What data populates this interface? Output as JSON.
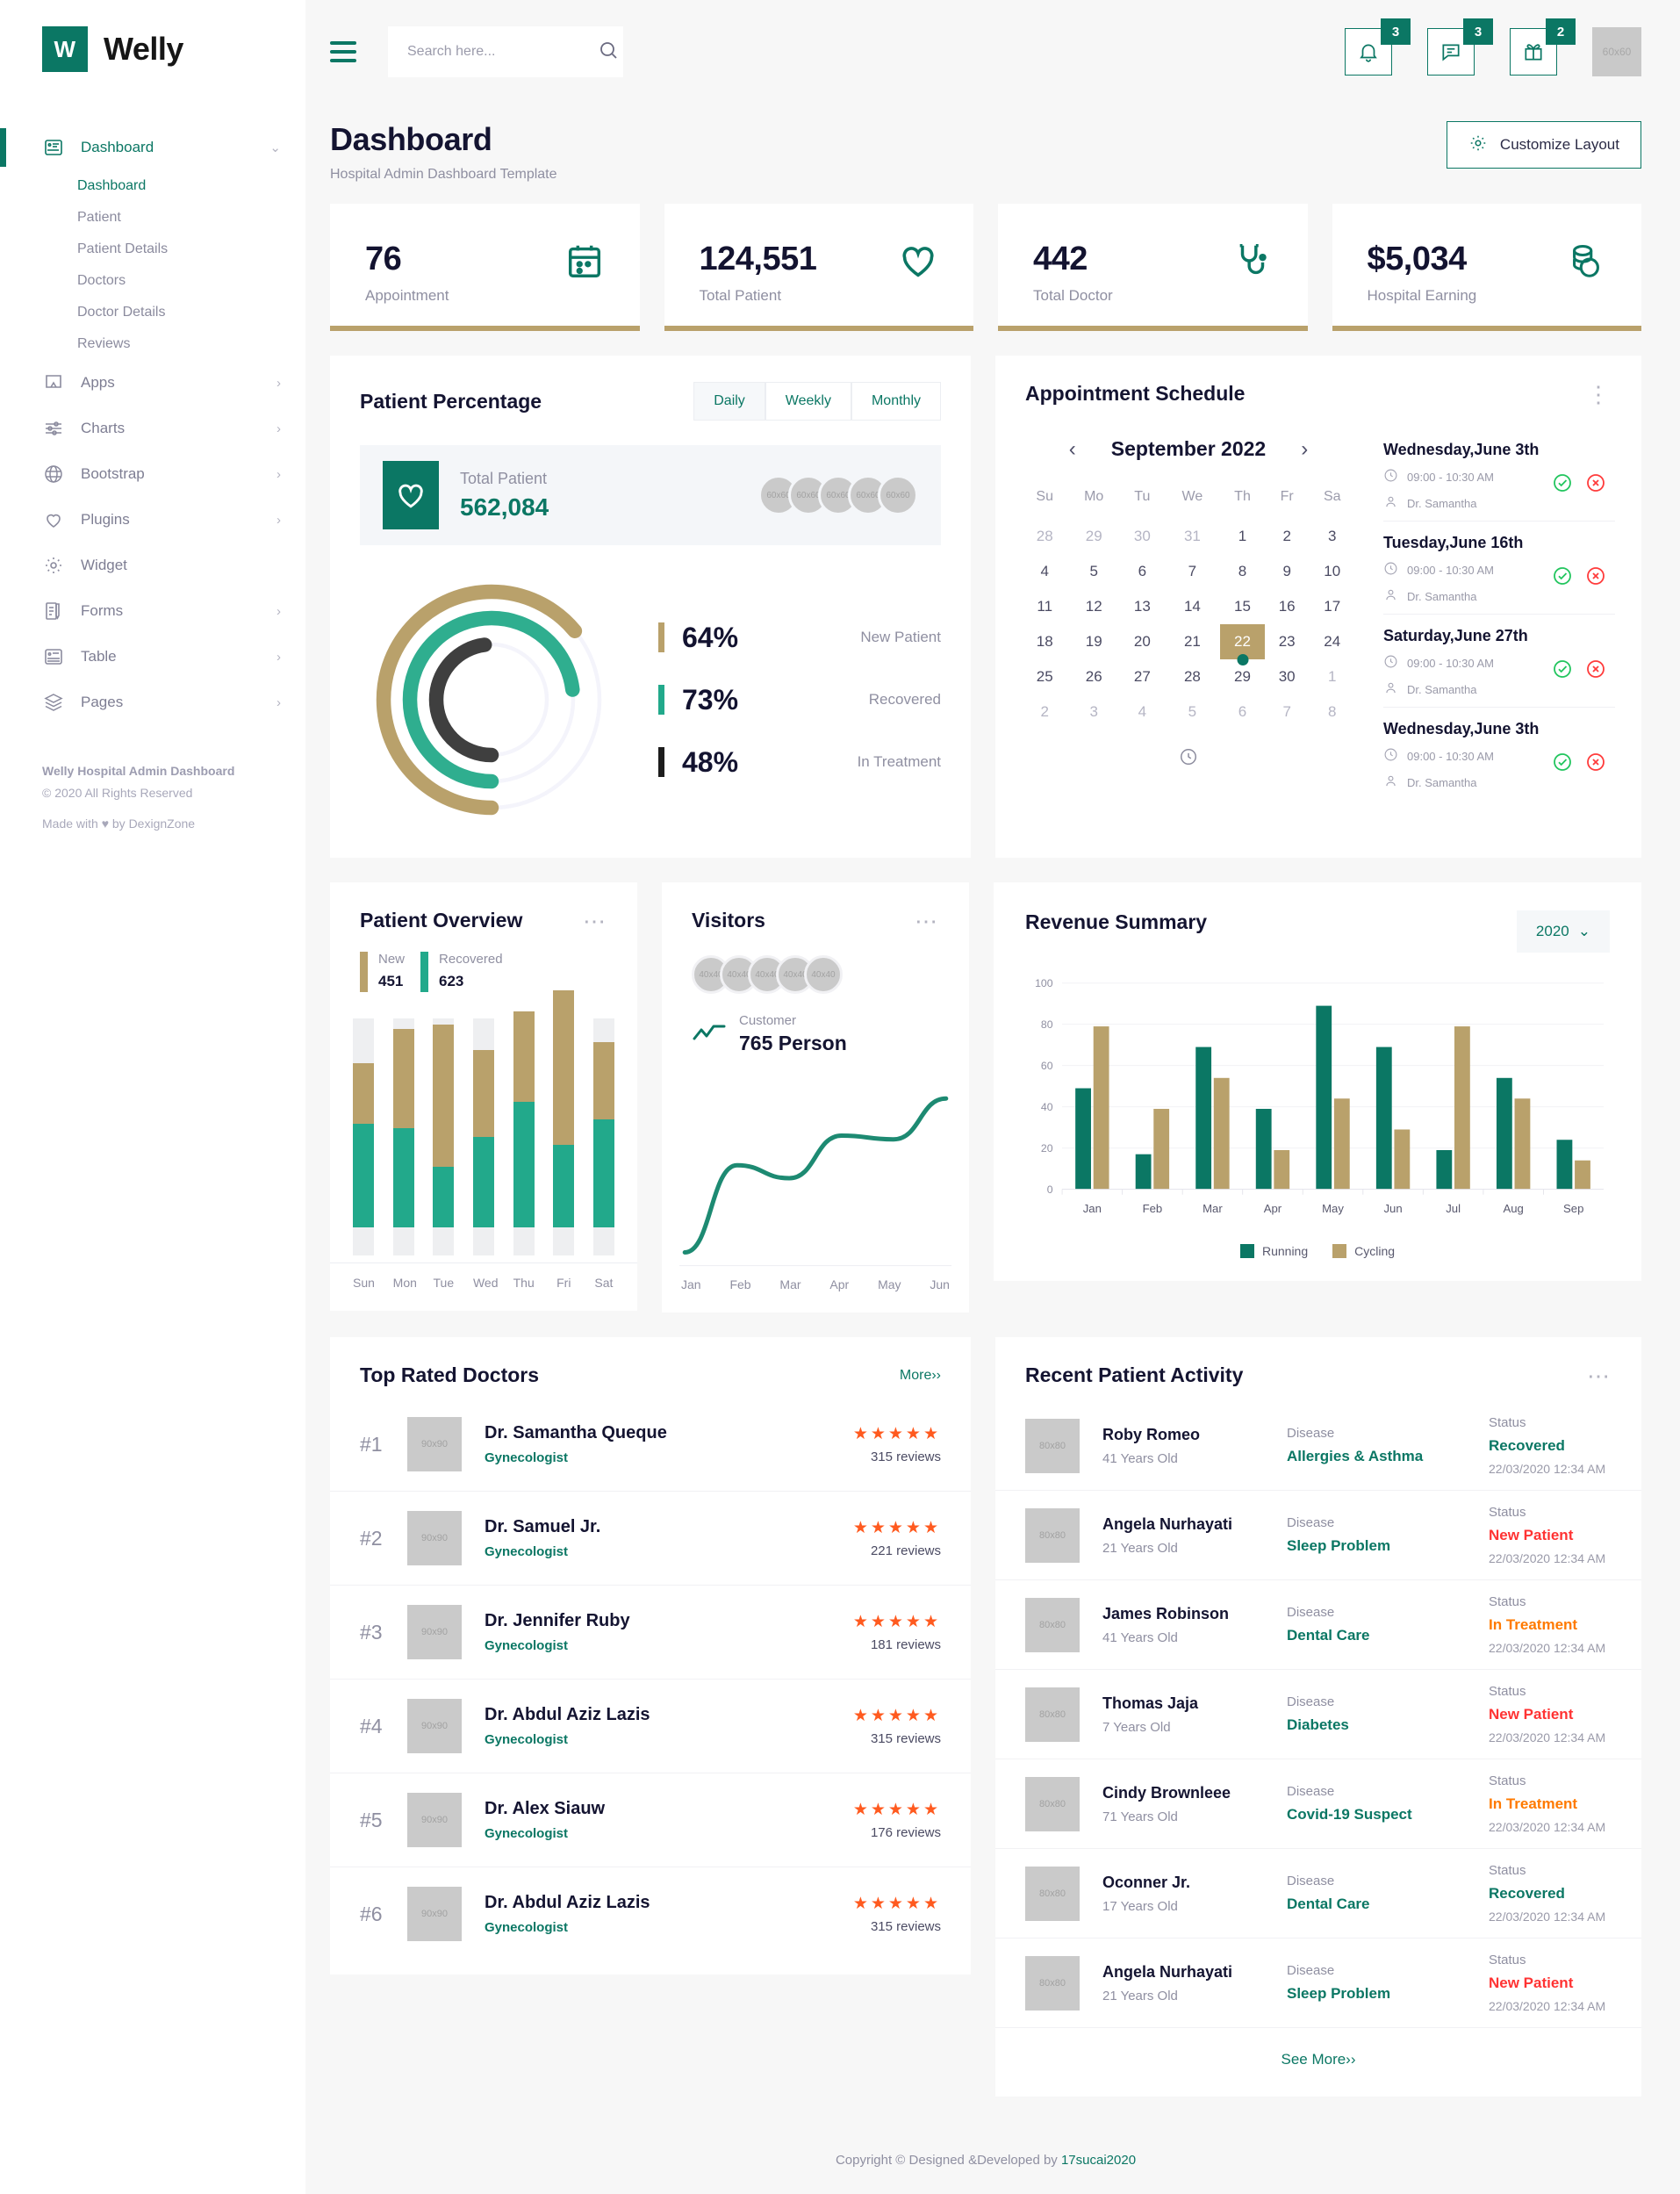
{
  "brand": {
    "mark": "W",
    "name": "Welly"
  },
  "sidebar": {
    "items": [
      {
        "label": "Dashboard",
        "icon": "dashboard-icon",
        "caret": "⌄",
        "active": true
      },
      {
        "label": "Apps",
        "icon": "apps-icon",
        "caret": "›"
      },
      {
        "label": "Charts",
        "icon": "charts-icon",
        "caret": "›"
      },
      {
        "label": "Bootstrap",
        "icon": "globe-icon",
        "caret": "›"
      },
      {
        "label": "Plugins",
        "icon": "heart-icon",
        "caret": "›"
      },
      {
        "label": "Widget",
        "icon": "gear-icon",
        "caret": ""
      },
      {
        "label": "Forms",
        "icon": "forms-icon",
        "caret": "›"
      },
      {
        "label": "Table",
        "icon": "table-icon",
        "caret": "›"
      },
      {
        "label": "Pages",
        "icon": "pages-icon",
        "caret": "›"
      }
    ],
    "sub_items": [
      {
        "label": "Dashboard",
        "active": true
      },
      {
        "label": "Patient"
      },
      {
        "label": "Patient Details"
      },
      {
        "label": "Doctors"
      },
      {
        "label": "Doctor Details"
      },
      {
        "label": "Reviews"
      }
    ],
    "footer": {
      "title": "Welly Hospital Admin Dashboard",
      "copyright": "© 2020 All Rights Reserved",
      "made": "Made with ♥ by DexignZone"
    }
  },
  "header": {
    "search_placeholder": "Search here...",
    "notifications_badge": "3",
    "messages_badge": "3",
    "gifts_badge": "2",
    "avatar_label": "60x60"
  },
  "page": {
    "title": "Dashboard",
    "subtitle": "Hospital Admin Dashboard Template",
    "customize_label": "Customize Layout"
  },
  "stats": [
    {
      "value": "76",
      "label": "Appointment",
      "icon": "calendar-icon"
    },
    {
      "value": "124,551",
      "label": "Total Patient",
      "icon": "heart-icon"
    },
    {
      "value": "442",
      "label": "Total Doctor",
      "icon": "stethoscope-icon"
    },
    {
      "value": "$5,034",
      "label": "Hospital Earning",
      "icon": "coins-icon"
    }
  ],
  "patient_percentage": {
    "title": "Patient Percentage",
    "tabs": [
      {
        "label": "Daily",
        "active": true
      },
      {
        "label": "Weekly",
        "active": false
      },
      {
        "label": "Monthly",
        "active": false
      }
    ],
    "total_label": "Total Patient",
    "total_value": "562,084",
    "avatars": [
      "60x60",
      "60x60",
      "60x60",
      "60x60",
      "60x60"
    ],
    "chart_data": {
      "type": "pie",
      "title": "Patient Percentage",
      "legend_position": "right",
      "categories": [
        "New Patient",
        "Recovered",
        "In Treatment"
      ],
      "values": [
        64,
        73,
        48
      ],
      "labels": [
        "64%",
        "73%",
        "48%"
      ],
      "colors": [
        "#b9a16b",
        "#2fae8f",
        "#3f3f3f"
      ]
    }
  },
  "appointment_schedule": {
    "title": "Appointment Schedule",
    "month": "September 2022",
    "prev": "‹",
    "next": "›",
    "weekdays": [
      "Su",
      "Mo",
      "Tu",
      "We",
      "Th",
      "Fr",
      "Sa"
    ],
    "weeks": [
      [
        {
          "d": "28",
          "o": true
        },
        {
          "d": "29",
          "o": true
        },
        {
          "d": "30",
          "o": true
        },
        {
          "d": "31",
          "o": true
        },
        {
          "d": "1"
        },
        {
          "d": "2"
        },
        {
          "d": "3"
        }
      ],
      [
        {
          "d": "4"
        },
        {
          "d": "5"
        },
        {
          "d": "6"
        },
        {
          "d": "7"
        },
        {
          "d": "8"
        },
        {
          "d": "9"
        },
        {
          "d": "10"
        }
      ],
      [
        {
          "d": "11"
        },
        {
          "d": "12"
        },
        {
          "d": "13"
        },
        {
          "d": "14"
        },
        {
          "d": "15"
        },
        {
          "d": "16"
        },
        {
          "d": "17"
        }
      ],
      [
        {
          "d": "18"
        },
        {
          "d": "19"
        },
        {
          "d": "20"
        },
        {
          "d": "21"
        },
        {
          "d": "22",
          "sel": true
        },
        {
          "d": "23"
        },
        {
          "d": "24"
        }
      ],
      [
        {
          "d": "25"
        },
        {
          "d": "26"
        },
        {
          "d": "27"
        },
        {
          "d": "28"
        },
        {
          "d": "29"
        },
        {
          "d": "30"
        },
        {
          "d": "1",
          "o": true
        }
      ],
      [
        {
          "d": "2",
          "o": true
        },
        {
          "d": "3",
          "o": true
        },
        {
          "d": "4",
          "o": true
        },
        {
          "d": "5",
          "o": true
        },
        {
          "d": "6",
          "o": true
        },
        {
          "d": "7",
          "o": true
        },
        {
          "d": "8",
          "o": true
        }
      ]
    ],
    "appointments": [
      {
        "date": "Wednesday,June 3th",
        "time": "09:00 - 10:30 AM",
        "doctor": "Dr. Samantha"
      },
      {
        "date": "Tuesday,June 16th",
        "time": "09:00 - 10:30 AM",
        "doctor": "Dr. Samantha"
      },
      {
        "date": "Saturday,June 27th",
        "time": "09:00 - 10:30 AM",
        "doctor": "Dr. Samantha"
      },
      {
        "date": "Wednesday,June 3th",
        "time": "09:00 - 10:30 AM",
        "doctor": "Dr. Samantha"
      }
    ]
  },
  "patient_overview": {
    "title": "Patient Overview",
    "legend": [
      {
        "name": "New",
        "value": "451",
        "color": "#b9a16b"
      },
      {
        "name": "Recovered",
        "value": "623",
        "color": "#22a98b"
      }
    ],
    "chart_data": {
      "type": "bar",
      "title": "Patient Overview",
      "stacked": true,
      "categories": [
        "Sun",
        "Mon",
        "Tue",
        "Wed",
        "Thu",
        "Fri",
        "Sat"
      ],
      "series": [
        {
          "name": "Recovered",
          "color": "#22a98b",
          "values": [
            48,
            46,
            28,
            42,
            58,
            38,
            50
          ]
        },
        {
          "name": "New",
          "color": "#b9a16b",
          "values": [
            28,
            46,
            66,
            40,
            42,
            72,
            36
          ]
        }
      ],
      "ylim": [
        0,
        100
      ],
      "grid": false
    }
  },
  "visitors": {
    "title": "Visitors",
    "avatars": [
      "40x40",
      "40x40",
      "40x40",
      "40x40",
      "40x40"
    ],
    "customer_label": "Customer",
    "customer_value": "765 Person",
    "chart_data": {
      "type": "line",
      "title": "Visitors",
      "x": [
        "Jan",
        "Feb",
        "Mar",
        "Apr",
        "May",
        "Jun"
      ],
      "series": [
        {
          "name": "Customer",
          "color": "#1d8a72",
          "values": [
            5,
            52,
            45,
            68,
            66,
            88
          ]
        }
      ],
      "ylim": [
        0,
        100
      ],
      "grid": false
    }
  },
  "revenue": {
    "title": "Revenue Summary",
    "year": "2020",
    "chart_data": {
      "type": "bar",
      "title": "Revenue Summary",
      "categories": [
        "Jan",
        "Feb",
        "Mar",
        "Apr",
        "May",
        "Jun",
        "Jul",
        "Aug",
        "Sep"
      ],
      "series": [
        {
          "name": "Running",
          "color": "#0b7764",
          "values": [
            49,
            17,
            69,
            39,
            89,
            69,
            19,
            54,
            24
          ]
        },
        {
          "name": "Cycling",
          "color": "#b9a16b",
          "values": [
            79,
            39,
            54,
            19,
            44,
            29,
            79,
            44,
            14
          ]
        }
      ],
      "ylabel": "",
      "xlabel": "",
      "ylim": [
        0,
        100
      ],
      "yticks": [
        0,
        20,
        40,
        60,
        80,
        100
      ],
      "grid": true,
      "legend_position": "bottom"
    }
  },
  "top_doctors": {
    "title": "Top Rated Doctors",
    "more_label": "More››",
    "rows": [
      {
        "rank": "#1",
        "thumb": "90x90",
        "name": "Dr. Samantha Queque",
        "specialty": "Gynecologist",
        "stars": "★★★★★",
        "reviews": "315 reviews"
      },
      {
        "rank": "#2",
        "thumb": "90x90",
        "name": "Dr. Samuel Jr.",
        "specialty": "Gynecologist",
        "stars": "★★★★★",
        "reviews": "221 reviews"
      },
      {
        "rank": "#3",
        "thumb": "90x90",
        "name": "Dr. Jennifer Ruby",
        "specialty": "Gynecologist",
        "stars": "★★★★★",
        "reviews": "181 reviews"
      },
      {
        "rank": "#4",
        "thumb": "90x90",
        "name": "Dr. Abdul Aziz Lazis",
        "specialty": "Gynecologist",
        "stars": "★★★★★",
        "reviews": "315 reviews"
      },
      {
        "rank": "#5",
        "thumb": "90x90",
        "name": "Dr. Alex Siauw",
        "specialty": "Gynecologist",
        "stars": "★★★★★",
        "reviews": "176 reviews"
      },
      {
        "rank": "#6",
        "thumb": "90x90",
        "name": "Dr. Abdul Aziz Lazis",
        "specialty": "Gynecologist",
        "stars": "★★★★★",
        "reviews": "315 reviews"
      }
    ]
  },
  "recent_activity": {
    "title": "Recent Patient Activity",
    "disease_label": "Disease",
    "status_label": "Status",
    "see_more_label": "See More››",
    "rows": [
      {
        "thumb": "80x80",
        "name": "Roby Romeo",
        "age": "41 Years Old",
        "disease": "Allergies & Asthma",
        "status": "Recovered",
        "status_kind": "recovered",
        "time": "22/03/2020 12:34 AM"
      },
      {
        "thumb": "80x80",
        "name": "Angela Nurhayati",
        "age": "21 Years Old",
        "disease": "Sleep Problem",
        "status": "New Patient",
        "status_kind": "new",
        "time": "22/03/2020 12:34 AM"
      },
      {
        "thumb": "80x80",
        "name": "James Robinson",
        "age": "41 Years Old",
        "disease": "Dental Care",
        "status": "In Treatment",
        "status_kind": "treat",
        "time": "22/03/2020 12:34 AM"
      },
      {
        "thumb": "80x80",
        "name": "Thomas Jaja",
        "age": "7 Years Old",
        "disease": "Diabetes",
        "status": "New Patient",
        "status_kind": "new",
        "time": "22/03/2020 12:34 AM"
      },
      {
        "thumb": "80x80",
        "name": "Cindy Brownleee",
        "age": "71 Years Old",
        "disease": "Covid-19 Suspect",
        "status": "In Treatment",
        "status_kind": "treat",
        "time": "22/03/2020 12:34 AM"
      },
      {
        "thumb": "80x80",
        "name": "Oconner Jr.",
        "age": "17 Years Old",
        "disease": "Dental Care",
        "status": "Recovered",
        "status_kind": "recovered",
        "time": "22/03/2020 12:34 AM"
      },
      {
        "thumb": "80x80",
        "name": "Angela Nurhayati",
        "age": "21 Years Old",
        "disease": "Sleep Problem",
        "status": "New Patient",
        "status_kind": "new",
        "time": "22/03/2020 12:34 AM"
      }
    ]
  },
  "footer": {
    "text": "Copyright © Designed &Developed by ",
    "link": "17sucai2020"
  },
  "colors": {
    "teal": "#0b7764",
    "gold": "#b9a16b",
    "green": "#22a98b",
    "red": "#ff3333",
    "orange": "#ff7a00",
    "star": "#ff5a1f"
  }
}
